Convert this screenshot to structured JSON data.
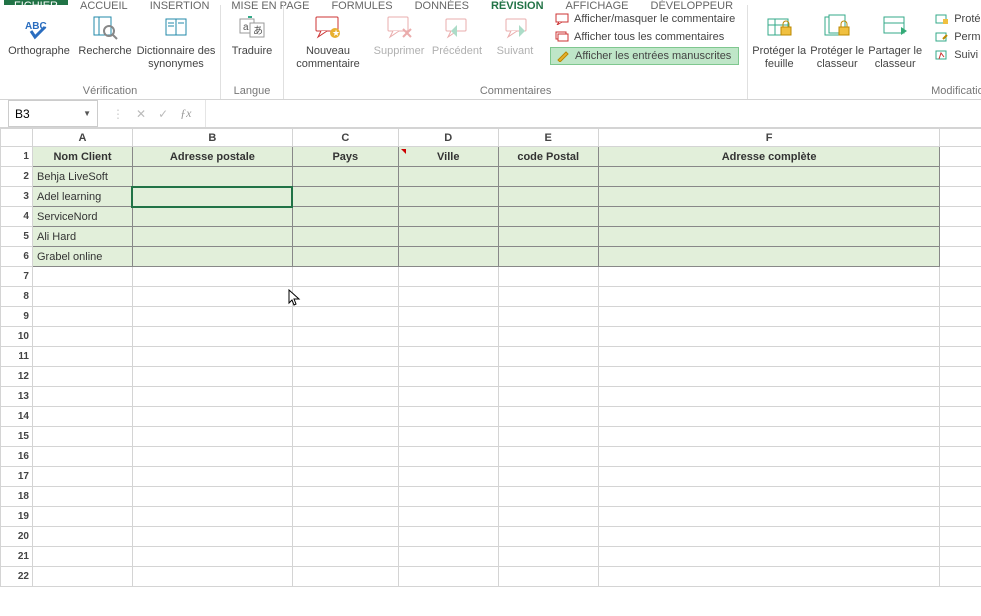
{
  "tabs": {
    "fichier": "FICHIER",
    "accueil": "ACCUEIL",
    "insertion": "INSERTION",
    "mise_en_page": "MISE EN PAGE",
    "formules": "FORMULES",
    "donnees": "DONNÉES",
    "revision": "RÉVISION",
    "affichage": "AFFICHAGE",
    "developpeur": "DÉVELOPPEUR"
  },
  "ribbon": {
    "verification": {
      "ortho": "Orthographe",
      "recherche": "Recherche",
      "dict": "Dictionnaire des synonymes",
      "group": "Vérification"
    },
    "langue": {
      "traduire": "Traduire",
      "group": "Langue"
    },
    "commentaires": {
      "nouveau": "Nouveau commentaire",
      "supprimer": "Supprimer",
      "precedent": "Précédent",
      "suivant": "Suivant",
      "afficher_masquer": "Afficher/masquer le commentaire",
      "afficher_tous": "Afficher tous les commentaires",
      "afficher_manuscrites": "Afficher les entrées manuscrites",
      "group": "Commentaires"
    },
    "modifications": {
      "proteger_feuille": "Protéger la feuille",
      "proteger_classeur": "Protéger le classeur",
      "partager_classeur": "Partager le classeur",
      "protege": "Protége",
      "permet": "Permet",
      "suivi": "Suivi de",
      "group": "Modifications"
    }
  },
  "namebox": "B3",
  "columns": [
    "A",
    "B",
    "C",
    "D",
    "E",
    "F"
  ],
  "table": {
    "headers": [
      "Nom Client",
      "Adresse postale",
      "Pays",
      "Ville",
      "code Postal",
      "Adresse complète"
    ],
    "rows": [
      [
        "Behja LiveSoft",
        "",
        "",
        "",
        "",
        ""
      ],
      [
        "Adel learning",
        "",
        "",
        "",
        "",
        ""
      ],
      [
        "ServiceNord",
        "",
        "",
        "",
        "",
        ""
      ],
      [
        "Ali Hard",
        "",
        "",
        "",
        "",
        ""
      ],
      [
        "Grabel online",
        "",
        "",
        "",
        "",
        ""
      ]
    ]
  }
}
